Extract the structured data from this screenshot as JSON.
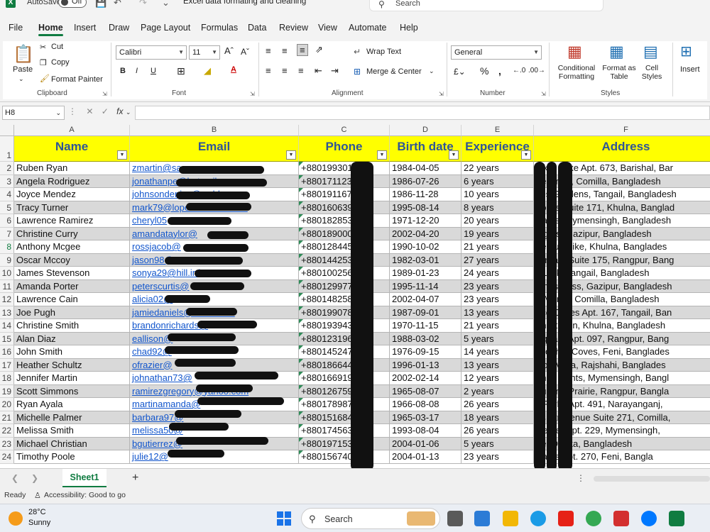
{
  "titlebar": {
    "autosave_label": "AutoSave",
    "autosave_state": "Off",
    "filename": "Excel data formating and cleaning",
    "search_placeholder": "Search"
  },
  "menu": {
    "tabs": [
      "File",
      "Home",
      "Insert",
      "Draw",
      "Page Layout",
      "Formulas",
      "Data",
      "Review",
      "View",
      "Automate",
      "Help"
    ],
    "active": "Home"
  },
  "ribbon": {
    "clipboard": {
      "paste": "Paste",
      "cut": "Cut",
      "copy": "Copy",
      "format_painter": "Format Painter",
      "group": "Clipboard"
    },
    "font": {
      "name": "Calibri",
      "size": "11",
      "group": "Font"
    },
    "alignment": {
      "wrap_text": "Wrap Text",
      "merge_center": "Merge & Center",
      "group": "Alignment"
    },
    "number": {
      "format": "General",
      "group": "Number"
    },
    "styles": {
      "conditional": "Conditional Formatting",
      "format_as_table": "Format as Table",
      "cell_styles": "Cell Styles",
      "group": "Styles"
    },
    "cells": {
      "insert": "Insert"
    }
  },
  "formula_bar": {
    "name_box": "H8",
    "fx": "fx",
    "value": ""
  },
  "grid": {
    "columns": [
      "A",
      "B",
      "C",
      "D",
      "E",
      "F"
    ],
    "headers": [
      "Name",
      "Email",
      "Phone",
      "Birth date",
      "Experience",
      "Address"
    ],
    "row_numbers": [
      "1",
      "2",
      "3",
      "4",
      "5",
      "6",
      "7",
      "8",
      "9",
      "10",
      "11",
      "12",
      "13",
      "14",
      "15",
      "16",
      "17",
      "18",
      "19",
      "20",
      "21",
      "22",
      "23",
      "24"
    ],
    "rows": [
      [
        "Ruben Ryan",
        "zmartin@sa",
        "+880199301",
        "1984-04-05",
        "22 years",
        "alker Lake Apt. 673, Barishal, Bar"
      ],
      [
        "Angela Rodriguez",
        "jonathanpe@hotmail.com",
        "+880171123",
        "1986-07-26",
        "6 years",
        "ne Crest, Comilla, Bangladesh"
      ],
      [
        "Joyce Mendez",
        "johnsondenise@webb.com",
        "+880191167",
        "1986-11-28",
        "10 years",
        "yes Gardens, Tangail, Bangladesh"
      ],
      [
        "Tracy Turner",
        "mark79@lopez-medina.com",
        "+880160639",
        "1995-08-14",
        "8 years",
        "Locks Suite 171, Khulna, Banglad"
      ],
      [
        "Lawrence Ramirez",
        "cheryl05",
        "+880182853",
        "1971-12-20",
        "20 years",
        "Parks, Mymensingh, Bangladesh"
      ],
      [
        "Christine Curry",
        "amandataylor@",
        "+880189000",
        "2002-04-20",
        "19 years",
        "Lights, Gazipur, Bangladesh"
      ],
      [
        "Anthony Mcgee",
        "rossjacob@",
        "+880128445",
        "1990-10-02",
        "21 years",
        "rie Turnpike, Khulna, Banglades"
      ],
      [
        "Oscar Mccoy",
        "jason98@",
        "+880144253",
        "1982-03-01",
        "27 years",
        "Stream Suite 175, Rangpur, Bang"
      ],
      [
        "James Stevenson",
        "sonya29@hill.info",
        "+880100256",
        "1989-01-23",
        "24 years",
        "r Lock, Tangail, Bangladesh"
      ],
      [
        "Amanda Porter",
        "peterscurtis@",
        "+880129977",
        "1995-11-14",
        "23 years",
        "nings Pass, Gazipur, Bangladesh"
      ],
      [
        "Lawrence Cain",
        "alicia02@",
        "+880148258",
        "2002-04-07",
        "23 years",
        "a Manor, Comilla, Bangladesh"
      ],
      [
        "Joe Pugh",
        "jamiedaniels@webb.com",
        "+880199078",
        "1987-09-01",
        "13 years",
        "ace Coves Apt. 167, Tangail, Ban"
      ],
      [
        "Christine Smith",
        "brandonrichards@",
        "+880193943",
        "1970-11-15",
        "21 years",
        "on Station, Khulna, Bangladesh"
      ],
      [
        "Alan Diaz",
        "eallison@",
        "+880123196",
        "1988-03-02",
        "5 years",
        "Square Apt. 097, Rangpur, Bang"
      ],
      [
        "John Smith",
        "chad92@",
        "+880145247",
        "1976-09-15",
        "14 years",
        "istopher Coves, Feni, Banglades"
      ],
      [
        "Heather Schultz",
        "ofrazier@",
        "+880186644",
        "1996-01-13",
        "13 years",
        "ilton Vista, Rajshahi, Banglades"
      ],
      [
        "Jennifer Martin",
        "johnathan73@",
        "+880166919",
        "2002-02-14",
        "12 years",
        "nnell Lights, Mymensingh, Bangl"
      ],
      [
        "Scott Simmons",
        "ramirezgregory@yahoo.com",
        "+880126759",
        "1965-08-07",
        "2 years",
        "queline Prairie, Rangpur, Bangla"
      ],
      [
        "Ryan Ayala",
        "martinamanda@",
        "+880178987",
        "1966-08-08",
        "26 years",
        "y Forks Apt. 491, Narayanganj,"
      ],
      [
        "Michelle Palmer",
        "barbara97@",
        "+880151684",
        "1965-03-17",
        "18 years",
        "es Stravenue Suite 271, Comilla,"
      ],
      [
        "Melissa Smith",
        "melissa50@",
        "+880174563",
        "1993-08-04",
        "26 years",
        "Center Apt. 229, Mymensingh,"
      ],
      [
        "Michael Christian",
        "bgutierrez@",
        "+880197153",
        "2004-01-06",
        "5 years",
        "ne, Dhaka, Bangladesh"
      ],
      [
        "Timothy Poole",
        "julie12@",
        "+880156740",
        "2004-01-13",
        "23 years",
        "Parks Apt. 270, Feni, Bangla"
      ]
    ]
  },
  "sheets": {
    "tabs": [
      "Sheet1"
    ],
    "add": "+"
  },
  "status": {
    "ready": "Ready",
    "accessibility": "Accessibility: Good to go"
  },
  "taskbar": {
    "temp": "28°C",
    "weather": "Sunny",
    "search": "Search"
  },
  "colors": {
    "header_fill": "#ffff00",
    "header_text": "#2f5597",
    "excel_green": "#107c41",
    "alt_row": "#d9d9d9"
  }
}
